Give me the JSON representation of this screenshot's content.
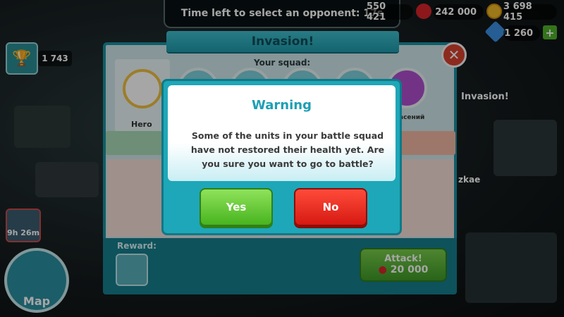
{
  "hud": {
    "timer_text": "Time left to select an opponent: 17s",
    "res1_value": "550 421",
    "apples_value": "242 000",
    "coins_value": "3 698 415",
    "gems_value": "1 260",
    "trophies_value": "1 743",
    "goblin_timer": "9h 26m",
    "map_label": "Map",
    "invasion_marker_label": "Invasion!",
    "player_name_partial": "zkae"
  },
  "panel": {
    "title": "Invasion!",
    "squad_label": "Your squad:",
    "hero_label": "Hero",
    "unit_label_partial": "асений",
    "reward_label": "Reward:",
    "attack_label": "Attack!",
    "attack_cost": "20 000"
  },
  "dialog": {
    "title": "Warning",
    "message": "Some of the units in your battle squad have not restored their health yet. Are you sure you want to go to battle?",
    "yes_label": "Yes",
    "no_label": "No"
  },
  "colors": {
    "accent": "#1ea7b8",
    "yes": "#48b41f",
    "no": "#d61a12"
  }
}
